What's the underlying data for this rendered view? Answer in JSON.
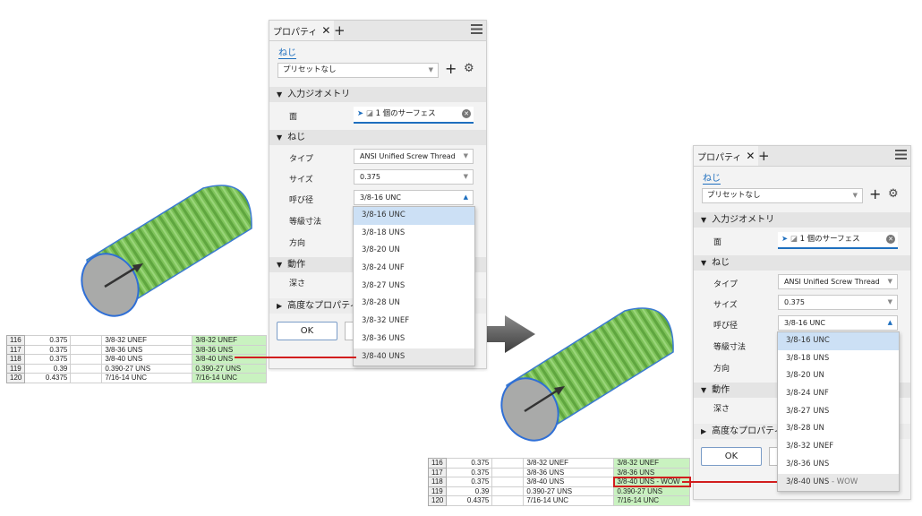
{
  "panel": {
    "tab_title": "プロパティ",
    "close_glyph": "✕",
    "add_glyph": "+",
    "feature_name": "ねじ",
    "preset": "プリセットなし",
    "section_input": "入力ジオメトリ",
    "face_label": "面",
    "face_value": "1 個のサーフェス",
    "section_thread": "ねじ",
    "type_label": "タイプ",
    "type_value": "ANSI Unified Screw Thread",
    "size_label": "サイズ",
    "size_value": "0.375",
    "designation_label": "呼び径",
    "designation_value": "3/8-16 UNC",
    "class_label": "等級寸法",
    "direction_label": "方向",
    "section_behavior": "動作",
    "depth_label": "深さ",
    "section_advanced": "高度なプロパティ",
    "ok_label": "OK"
  },
  "dropdown_left": [
    "3/8-16 UNC",
    "3/8-18 UNS",
    "3/8-20 UN",
    "3/8-24 UNF",
    "3/8-27 UNS",
    "3/8-28 UN",
    "3/8-32 UNEF",
    "3/8-36 UNS",
    "3/8-40 UNS"
  ],
  "dropdown_right": [
    "3/8-16 UNC",
    "3/8-18 UNS",
    "3/8-20 UN",
    "3/8-24 UNF",
    "3/8-27 UNS",
    "3/8-28 UN",
    "3/8-32 UNEF",
    "3/8-36 UNS",
    "3/8-40 UNS"
  ],
  "dropdown_right_suffix": "- WOW",
  "sheet_left": [
    [
      "116",
      "0.375",
      "",
      "3/8-32 UNEF",
      "3/8-32 UNEF"
    ],
    [
      "117",
      "0.375",
      "",
      "3/8-36 UNS",
      "3/8-36 UNS"
    ],
    [
      "118",
      "0.375",
      "",
      "3/8-40 UNS",
      "3/8-40 UNS"
    ],
    [
      "119",
      "0.39",
      "",
      "0.390-27 UNS",
      "0.390-27 UNS"
    ],
    [
      "120",
      "0.4375",
      "",
      "7/16-14 UNC",
      "7/16-14 UNC"
    ]
  ],
  "sheet_right": [
    [
      "116",
      "0.375",
      "",
      "3/8-32 UNEF",
      "3/8-32 UNEF"
    ],
    [
      "117",
      "0.375",
      "",
      "3/8-36 UNS",
      "3/8-36 UNS"
    ],
    [
      "118",
      "0.375",
      "",
      "3/8-40 UNS",
      "3/8-40 UNS - WOW"
    ],
    [
      "119",
      "0.39",
      "",
      "0.390-27 UNS",
      "0.390-27 UNS"
    ],
    [
      "120",
      "0.4375",
      "",
      "7/16-14 UNC",
      "7/16-14 UNC"
    ]
  ],
  "colors": {
    "accent": "#1e6fbf",
    "thread_green": "#7ec35a",
    "highlight_red": "#d21e1e",
    "cell_green": "#c9f2c0"
  }
}
